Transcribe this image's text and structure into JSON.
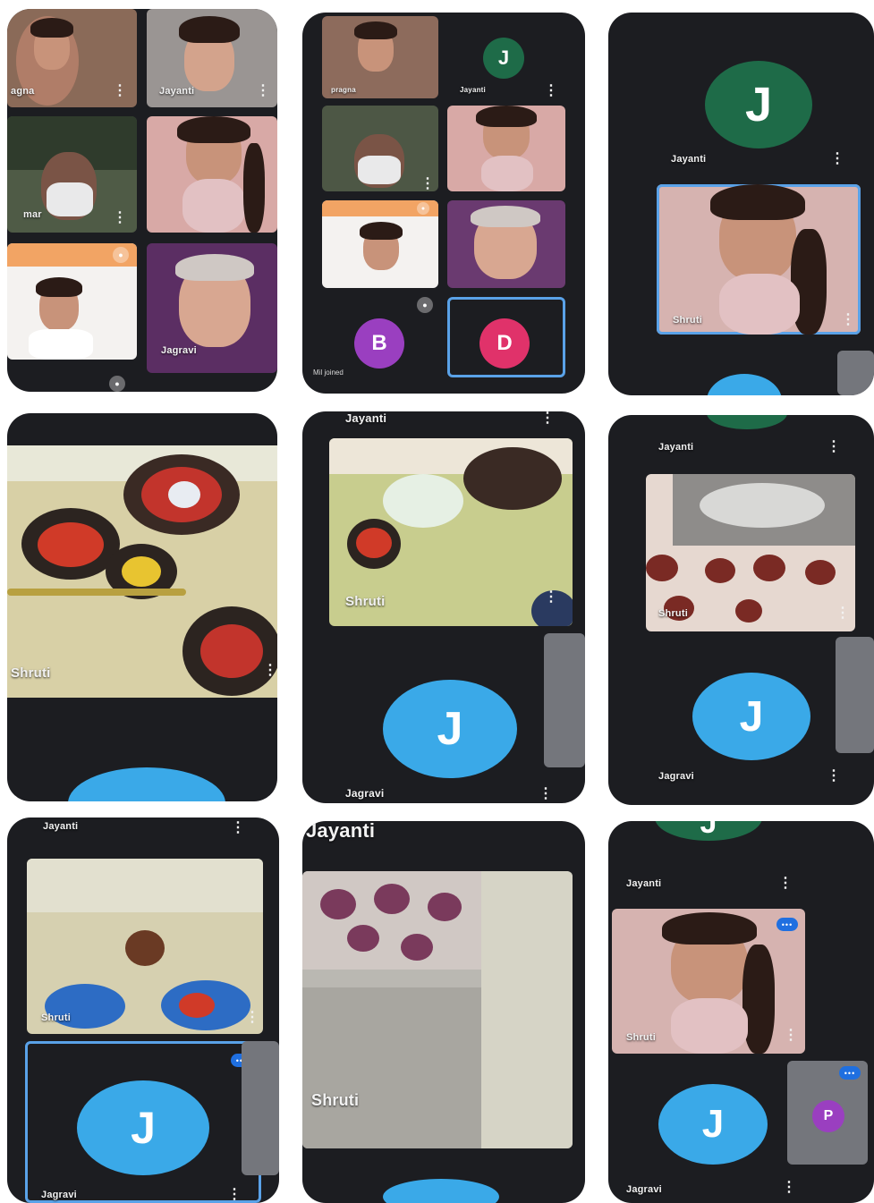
{
  "participants": {
    "jayanti": "Jayanti",
    "jagravi": "Jagravi",
    "shruti": "Shruti",
    "pragna": "pragna",
    "jagna": "agna",
    "kumar": "mar",
    "kumar_full": "kumar"
  },
  "avatars": {
    "j": "J",
    "b": "B",
    "d": "D",
    "p": "P"
  },
  "status": {
    "joined": "Mil joined"
  },
  "icons": {
    "more": "more-vert-icon",
    "mic": "mic-off-icon",
    "speaking": "speaking-indicator-icon"
  },
  "colors": {
    "phone_bg": "#1c1d21",
    "avatar_blue": "#3aa9e8",
    "avatar_green": "#1e6b48",
    "avatar_purple": "#9a3fc0",
    "avatar_pink": "#e0326a",
    "selected_outline": "#5aa2e8"
  }
}
